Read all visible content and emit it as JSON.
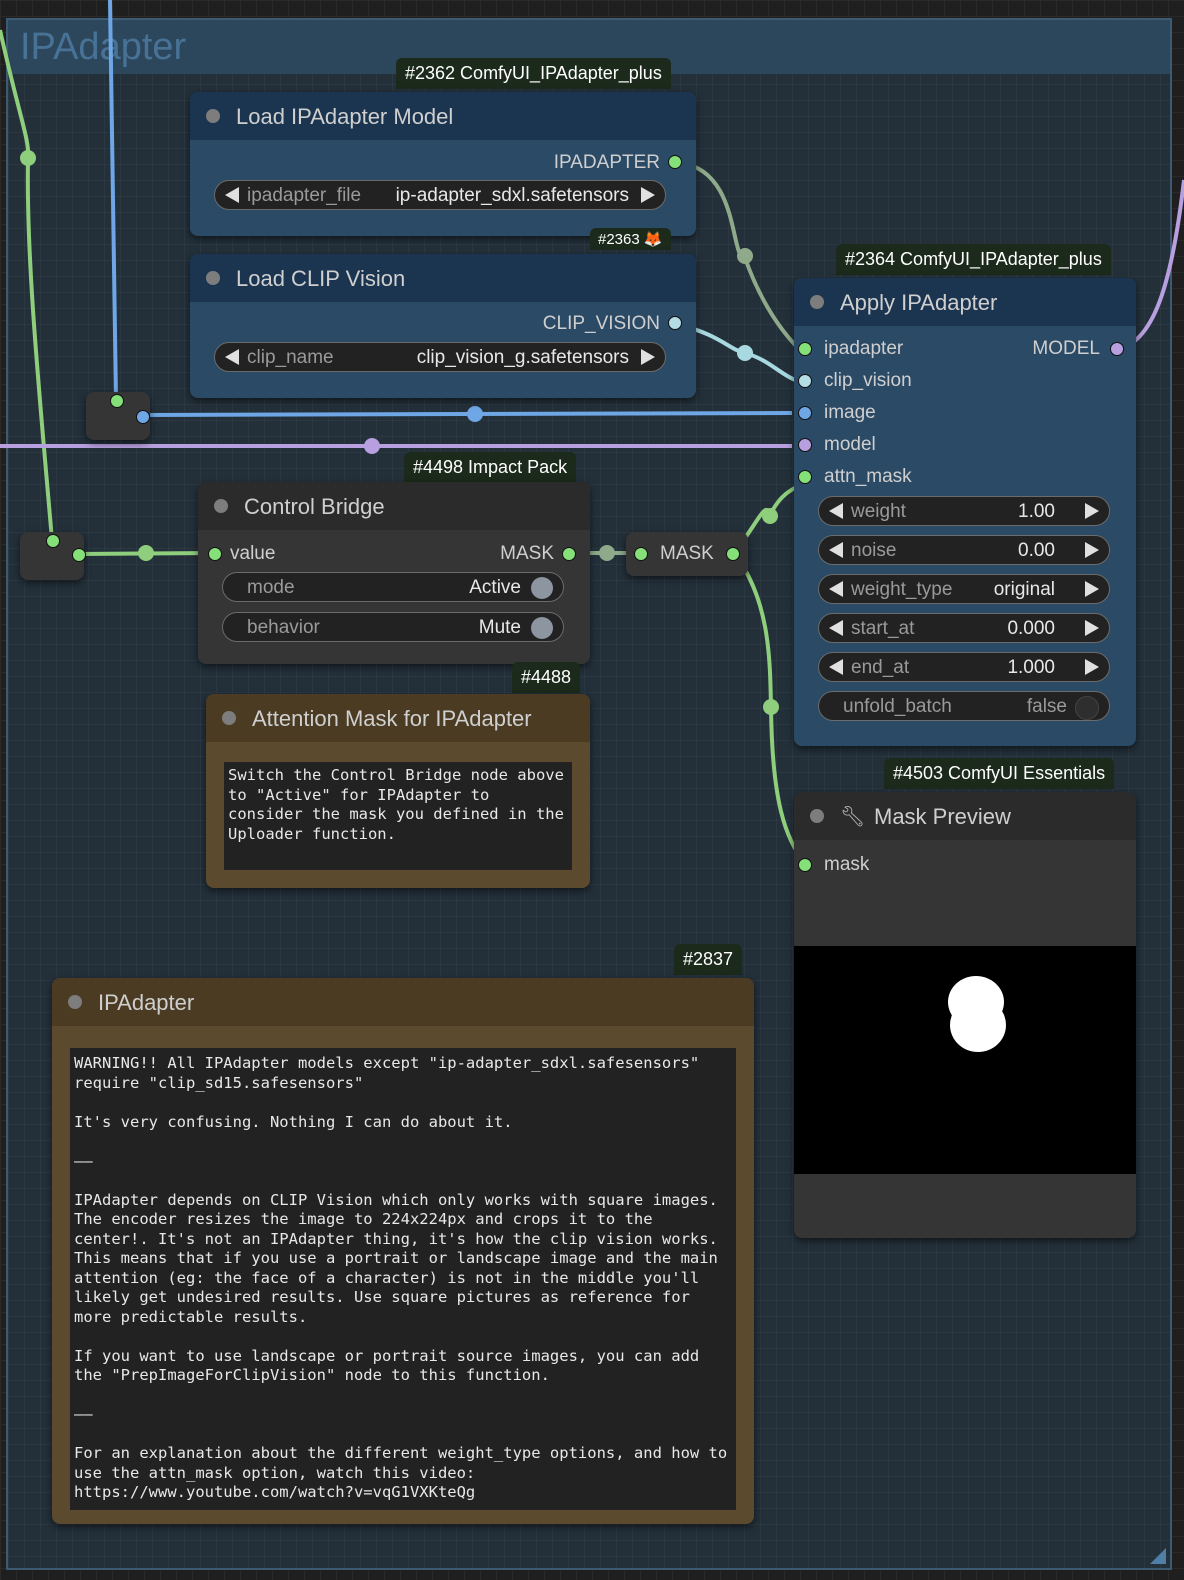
{
  "group": {
    "title": "IPAdapter"
  },
  "colors": {
    "group_bg": "#23303a",
    "wire_green": "#8fce7c",
    "wire_blue": "#6fa7e6",
    "wire_purple": "#b8a0e0",
    "wire_cyan": "#a8d8e0",
    "port_green": "#86e07a",
    "port_blue": "#6fa7e6",
    "port_purple": "#b8a0e0",
    "port_cyan": "#b4dde6"
  },
  "nodes": {
    "load_ipadapter": {
      "badge": "#2362 ComfyUI_IPAdapter_plus",
      "title": "Load IPAdapter Model",
      "output": "IPADAPTER",
      "widget": {
        "label": "ipadapter_file",
        "value": "ip-adapter_sdxl.safetensors"
      }
    },
    "load_clip_vision": {
      "badge": "#2363 🦊",
      "title": "Load CLIP Vision",
      "output": "CLIP_VISION",
      "widget": {
        "label": "clip_name",
        "value": "clip_vision_g.safetensors"
      }
    },
    "apply_ipadapter": {
      "badge": "#2364 ComfyUI_IPAdapter_plus",
      "title": "Apply IPAdapter",
      "inputs": [
        "ipadapter",
        "clip_vision",
        "image",
        "model",
        "attn_mask"
      ],
      "output": "MODEL",
      "widgets": [
        {
          "label": "weight",
          "value": "1.00"
        },
        {
          "label": "noise",
          "value": "0.00"
        },
        {
          "label": "weight_type",
          "value": "original"
        },
        {
          "label": "start_at",
          "value": "0.000"
        },
        {
          "label": "end_at",
          "value": "1.000"
        }
      ],
      "toggle": {
        "label": "unfold_batch",
        "value": "false"
      }
    },
    "control_bridge": {
      "badge": "#4498 Impact Pack",
      "title": "Control Bridge",
      "input": "value",
      "output": "MASK",
      "toggles": [
        {
          "label": "mode",
          "value": "Active"
        },
        {
          "label": "behavior",
          "value": "Mute"
        }
      ]
    },
    "mask_reroute": {
      "label": "MASK"
    },
    "attention_note": {
      "badge": "#4488",
      "title": "Attention Mask for IPAdapter",
      "text": "Switch the Control Bridge node above to \"Active\" for IPAdapter to consider the mask you defined in the Uploader function."
    },
    "mask_preview": {
      "badge": "#4503 ComfyUI Essentials",
      "icon": "wrench-icon",
      "title": "Mask Preview",
      "input": "mask"
    },
    "ipadapter_note": {
      "badge": "#2837",
      "title": "IPAdapter",
      "text": "WARNING!! All IPAdapter models except \"ip-adapter_sdxl.safesensors\" require \"clip_sd15.safesensors\"\n\nIt's very confusing. Nothing I can do about it.\n\n——\n\nIPAdapter depends on CLIP Vision which only works with square images. The encoder resizes the image to 224x224px and crops it to the center!. It's not an IPAdapter thing, it's how the clip vision works. This means that if you use a portrait or landscape image and the main attention (eg: the face of a character) is not in the middle you'll likely get undesired results. Use square pictures as reference for more predictable results.\n\nIf you want to use landscape or portrait source images, you can add the \"PrepImageForClipVision\" node to this function.\n\n——\n\nFor an explanation about the different weight_type options, and how to use the attn_mask option, watch this video:\nhttps://www.youtube.com/watch?v=vqG1VXKteQg"
    }
  }
}
